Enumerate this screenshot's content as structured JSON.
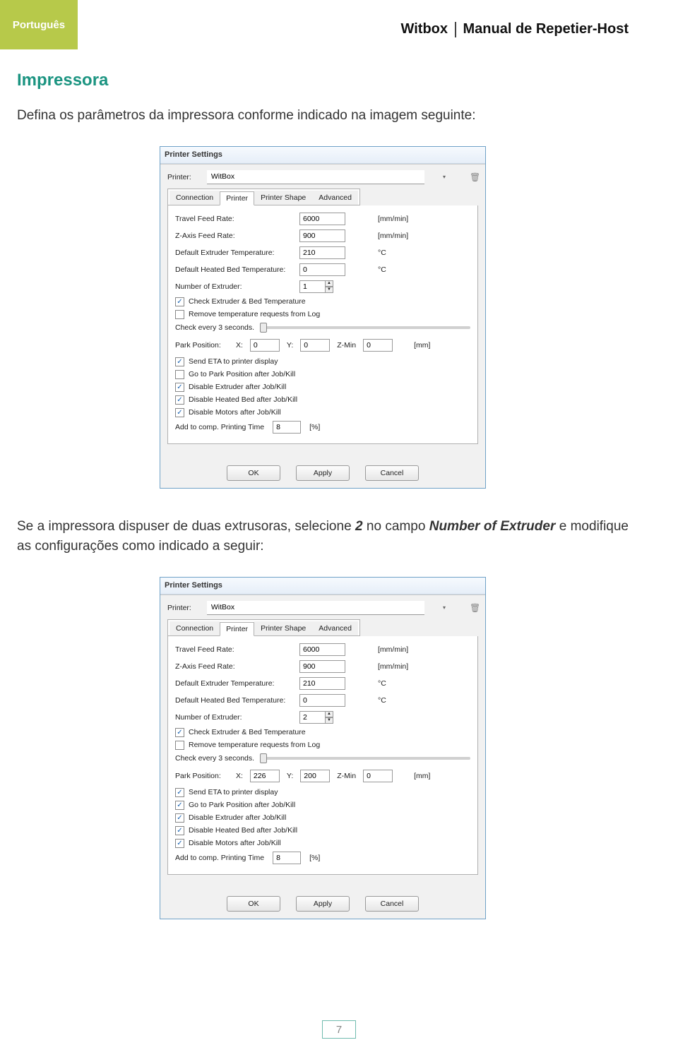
{
  "header": {
    "language": "Português",
    "brand": "Witbox",
    "manual": "Manual de Repetier-Host"
  },
  "section": {
    "heading": "Impressora",
    "intro": "Defina os parâmetros da impressora conforme indicado na imagem seguinte:",
    "mid_pre": "Se a impressora dispuser de duas extrusoras, selecione ",
    "mid_two": "2",
    "mid_mid": " no campo ",
    "mid_field": "Number of Extruder",
    "mid_post": " e modifique as configurações como indicado a seguir:"
  },
  "page_number": "7",
  "dialog": {
    "title": "Printer Settings",
    "printer_label": "Printer:",
    "tabs": {
      "connection": "Connection",
      "printer": "Printer",
      "shape": "Printer Shape",
      "advanced": "Advanced"
    },
    "labels": {
      "travel": "Travel Feed Rate:",
      "zaxis": "Z-Axis Feed Rate:",
      "ext_temp": "Default Extruder Temperature:",
      "bed_temp": "Default Heated Bed Temperature:",
      "num_ext": "Number of Extruder:",
      "check_temp": "Check Extruder & Bed Temperature",
      "remove_log": "Remove temperature requests from Log",
      "check_every": "Check every 3 seconds.",
      "park": "Park Position:",
      "x": "X:",
      "y": "Y:",
      "zmin": "Z-Min",
      "mm": "[mm]",
      "send_eta": "Send ETA to printer display",
      "go_park": "Go to Park Position after Job/Kill",
      "dis_ext": "Disable Extruder after Job/Kill",
      "dis_bed": "Disable Heated Bed after Job/Kill",
      "dis_mot": "Disable Motors after Job/Kill",
      "add_time": "Add to comp. Printing Time",
      "percent": "[%]"
    },
    "units": {
      "mmmin": "[mm/min]",
      "c": "°C"
    },
    "buttons": {
      "ok": "OK",
      "apply": "Apply",
      "cancel": "Cancel"
    }
  },
  "ps1": {
    "printer_name": "WitBox",
    "travel": "6000",
    "zaxis": "900",
    "ext_temp": "210",
    "bed_temp": "0",
    "num_ext": "1",
    "park_x": "0",
    "park_y": "0",
    "park_z": "0",
    "add_time": "8",
    "check_temp": true,
    "remove_log": false,
    "send_eta": true,
    "go_park": false,
    "dis_ext": true,
    "dis_bed": true,
    "dis_mot": true
  },
  "ps2": {
    "printer_name": "WitBox",
    "travel": "6000",
    "zaxis": "900",
    "ext_temp": "210",
    "bed_temp": "0",
    "num_ext": "2",
    "park_x": "226",
    "park_y": "200",
    "park_z": "0",
    "add_time": "8",
    "check_temp": true,
    "remove_log": false,
    "send_eta": true,
    "go_park": true,
    "dis_ext": true,
    "dis_bed": true,
    "dis_mot": true
  }
}
